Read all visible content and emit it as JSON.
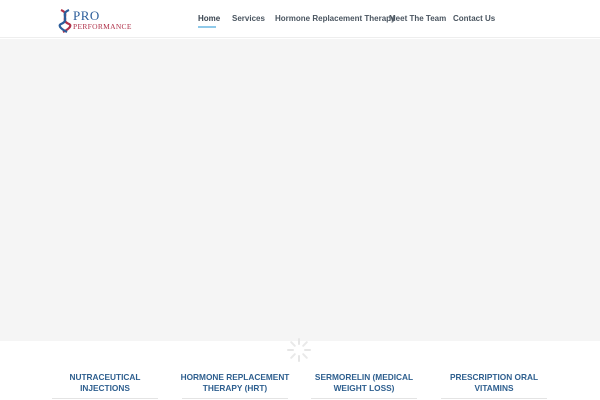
{
  "brand": {
    "name_top": "PRO",
    "name_bottom": "PERFORMANCE",
    "logo_icon": "dna-helix-icon",
    "colors": {
      "blue": "#2b5d9a",
      "red": "#b0324a"
    }
  },
  "nav": {
    "items": [
      {
        "label": "Home",
        "active": true
      },
      {
        "label": "Services"
      },
      {
        "label": "Hormone Replacement Therapy"
      },
      {
        "label": "Meet The Team"
      },
      {
        "label": "Contact Us"
      }
    ],
    "active_underline_color": "#8fc9e9"
  },
  "hero": {
    "background": "#f5f5f5"
  },
  "loader": {
    "icon": "loading-spinner-icon"
  },
  "services": {
    "cards": [
      {
        "title": "NUTRACEUTICAL INJECTIONS"
      },
      {
        "title": "HORMONE REPLACEMENT THERAPY (HRT)"
      },
      {
        "title": "SERMORELIN (MEDICAL WEIGHT LOSS)"
      },
      {
        "title": "PRESCRIPTION ORAL VITAMINS"
      }
    ],
    "title_color": "#2e5f8f"
  }
}
